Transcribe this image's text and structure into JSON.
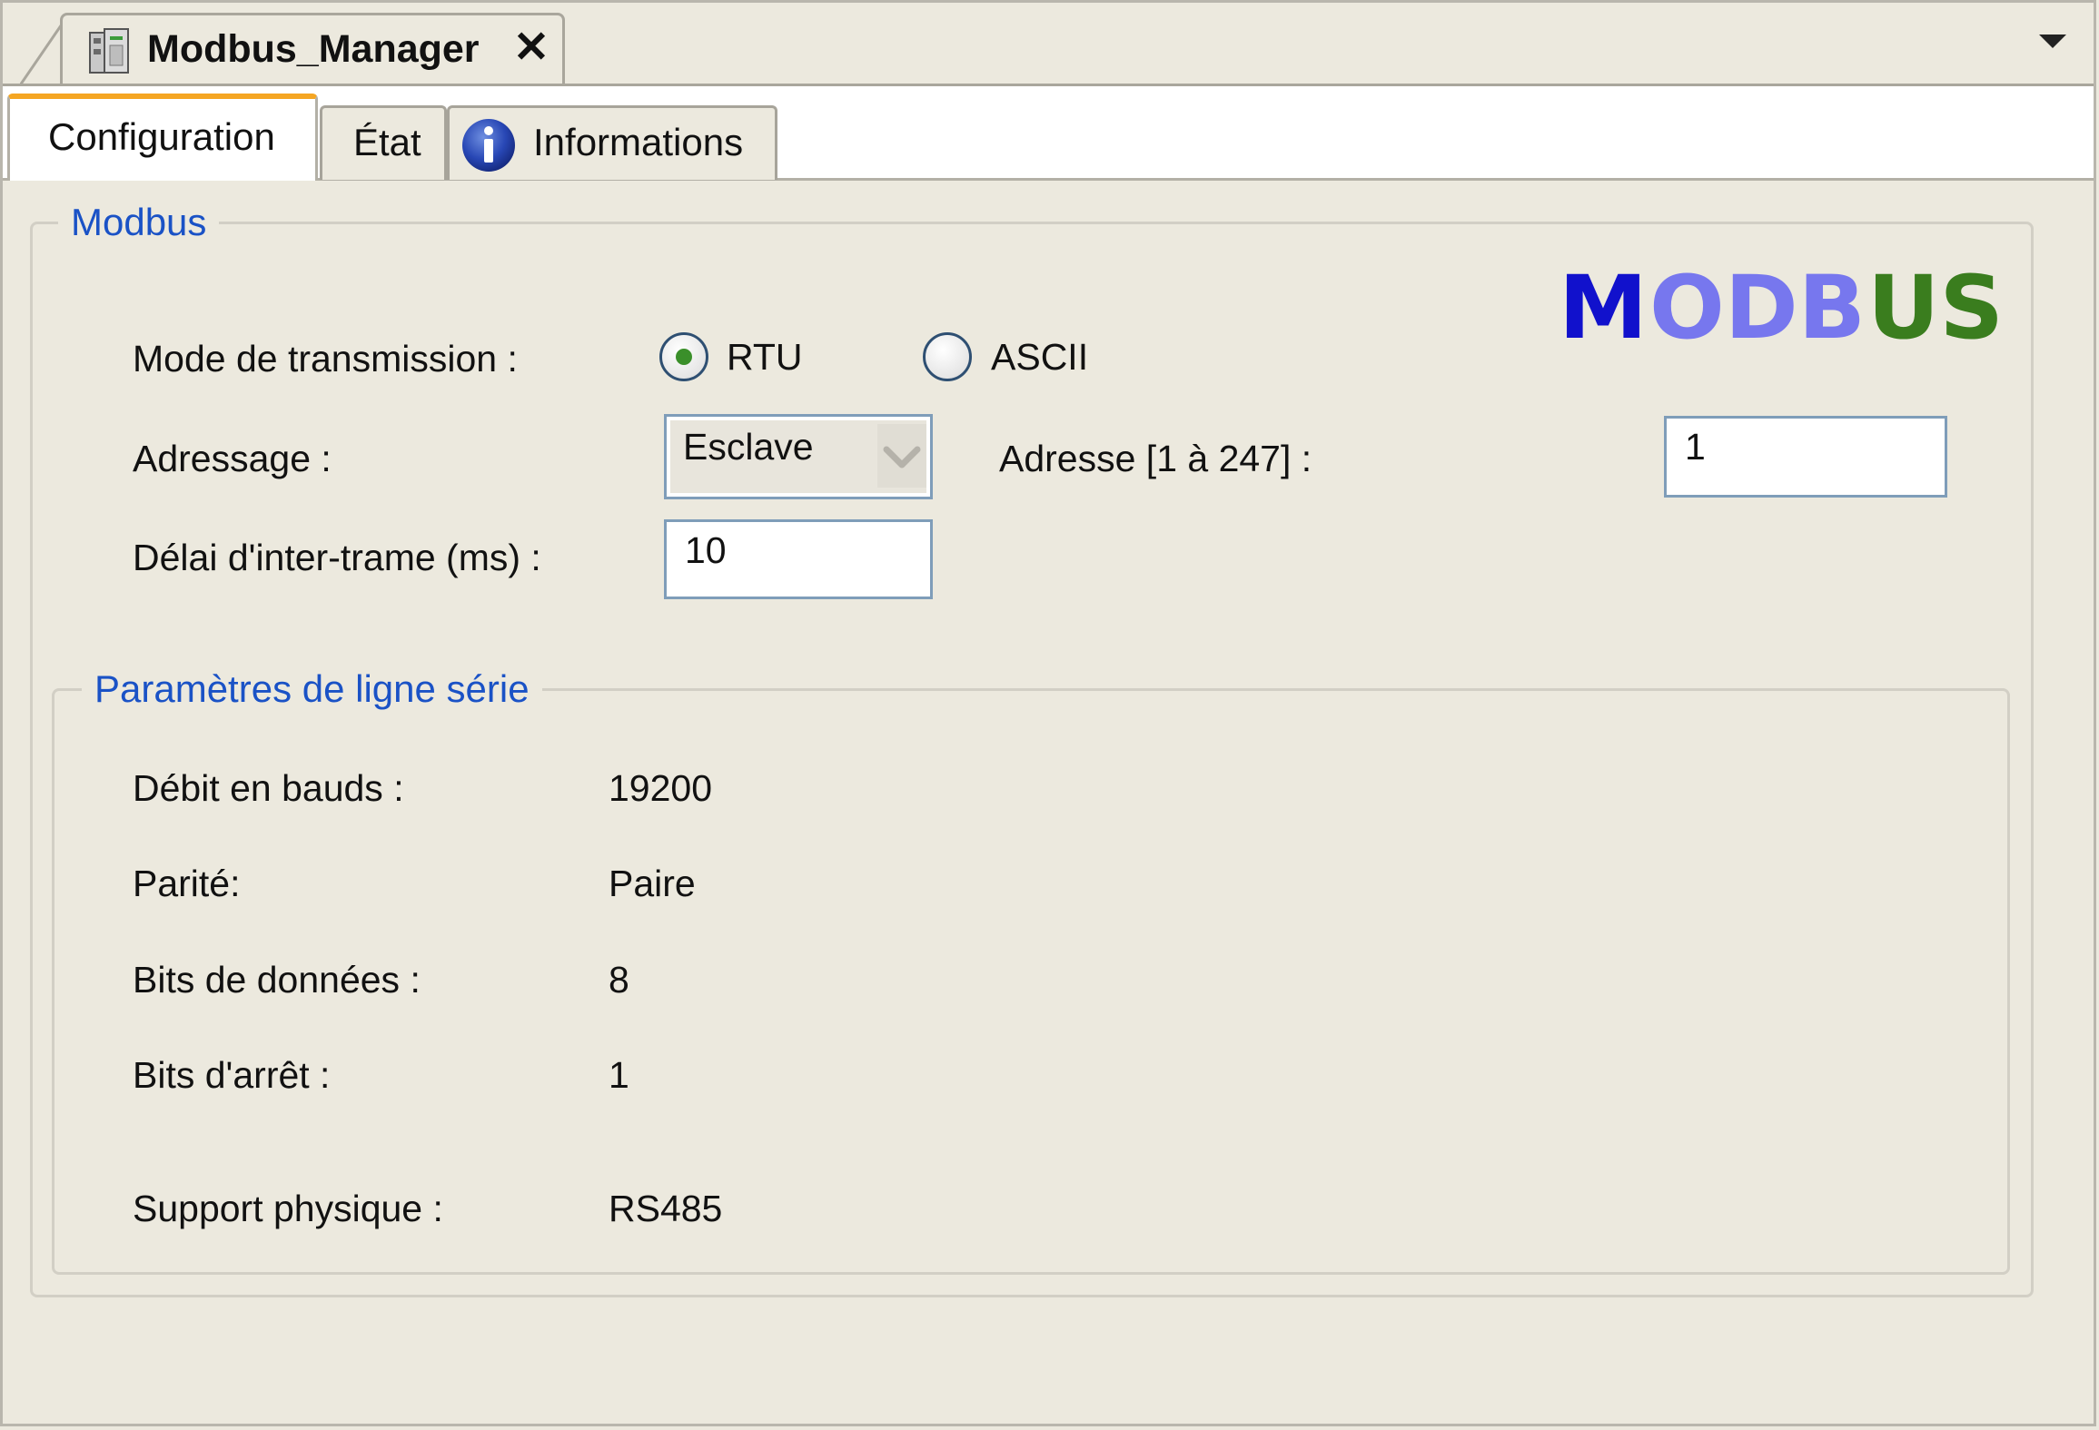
{
  "document_tab": {
    "title": "Modbus_Manager",
    "icon": "device-module-icon",
    "close_icon": "close-icon",
    "overflow_icon": "chevron-down-icon"
  },
  "tabs": [
    {
      "label": "Configuration",
      "active": true
    },
    {
      "label": "État",
      "active": false
    },
    {
      "label": "Informations",
      "active": false,
      "icon": "info-icon"
    }
  ],
  "modbus_group": {
    "legend": "Modbus",
    "logo_text": "MODBUS",
    "transmission_label": "Mode de transmission :",
    "transmission_options": [
      {
        "label": "RTU",
        "selected": true
      },
      {
        "label": "ASCII",
        "selected": false
      }
    ],
    "addressing_label": "Adressage :",
    "addressing_value": "Esclave",
    "address_label": "Adresse [1 à 247] :",
    "address_value": "1",
    "interframe_label": "Délai d'inter-trame (ms) :",
    "interframe_value": "10"
  },
  "serial_group": {
    "legend": "Paramètres de ligne série",
    "rows": [
      {
        "label": "Débit en bauds :",
        "value": "19200"
      },
      {
        "label": "Parité:",
        "value": "Paire"
      },
      {
        "label": "Bits de données :",
        "value": "8"
      },
      {
        "label": "Bits d'arrêt :",
        "value": "1"
      },
      {
        "label": "Support physique :",
        "value": "RS485"
      }
    ]
  },
  "colors": {
    "background": "#ece9de",
    "legend_blue": "#1a52c6",
    "active_tab_accent": "#f5a623",
    "radio_selected": "#3a8f2a",
    "logo_blue": "#1111cc",
    "logo_light_blue": "#7777ee",
    "logo_green": "#3a7d1e"
  }
}
